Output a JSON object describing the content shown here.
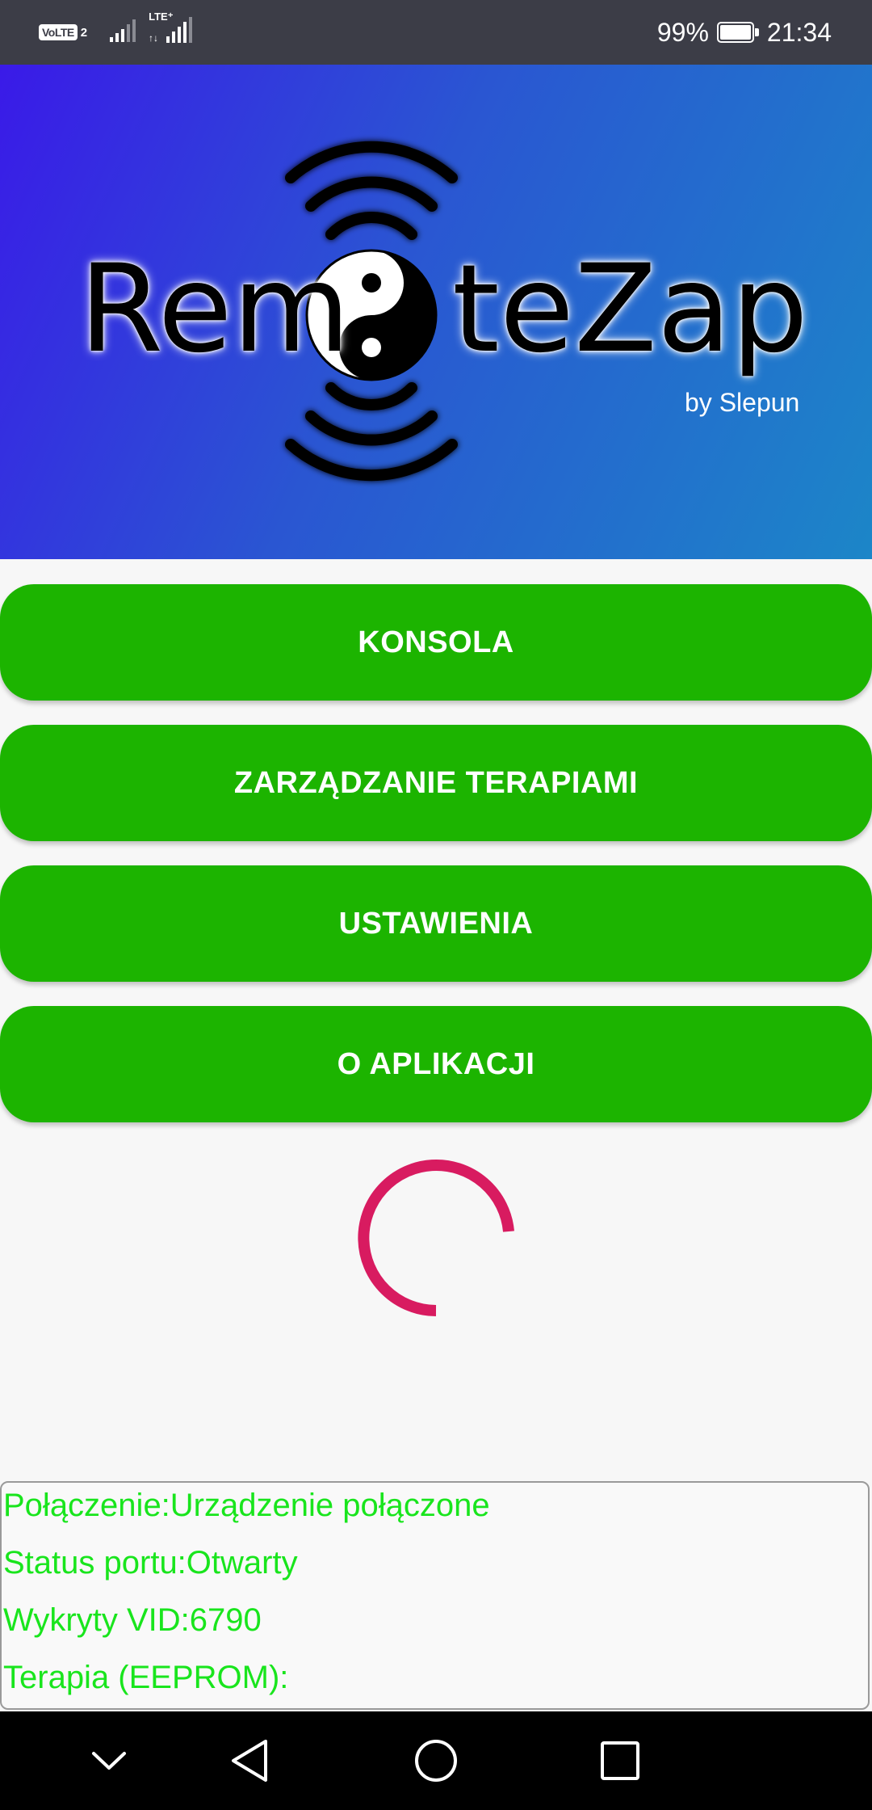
{
  "status_bar": {
    "volte_label": "VoLTE",
    "sim_number": "2",
    "lte_label": "LTE⁺",
    "battery_percent": "99%",
    "time": "21:34",
    "battery_level": 0.99
  },
  "banner": {
    "logo_left": "Rem",
    "logo_right": "teZap",
    "byline": "by Slepun",
    "icon": "yin-yang-icon"
  },
  "menu": {
    "buttons": [
      {
        "label": "KONSOLA"
      },
      {
        "label": "ZARZĄDZANIE TERAPIAMI"
      },
      {
        "label": "USTAWIENIA"
      },
      {
        "label": "O APLIKACJI"
      }
    ],
    "button_color": "#1cb400"
  },
  "spinner": {
    "color": "#d81b60",
    "icon": "loading-spinner"
  },
  "status_panel": {
    "text_color": "#19e51d",
    "lines": [
      "Połączenie:Urządzenie połączone",
      "Status portu:Otwarty",
      "Wykryty VID:6790",
      "Terapia (EEPROM):"
    ]
  },
  "nav_bar": {
    "icons": [
      "chevron-down-icon",
      "back-icon",
      "home-icon",
      "recents-icon"
    ]
  }
}
